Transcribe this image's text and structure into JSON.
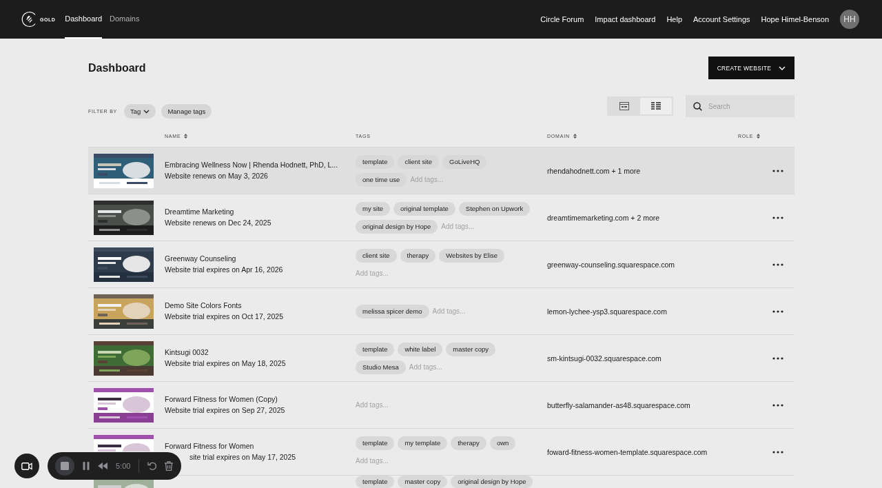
{
  "nav": {
    "logo_text": "GOLD",
    "tabs": [
      {
        "label": "Dashboard",
        "selected": true
      },
      {
        "label": "Domains",
        "selected": false
      }
    ],
    "links": [
      "Circle Forum",
      "Impact dashboard",
      "Help",
      "Account Settings"
    ],
    "user_name": "Hope Himel-Benson",
    "avatar_initials": "HH"
  },
  "page": {
    "title": "Dashboard",
    "create_button": "CREATE WEBSITE"
  },
  "filters": {
    "label": "FILTER BY",
    "tag_dropdown": "Tag",
    "manage_button": "Manage tags"
  },
  "view_toggle": [
    {
      "kind": "grid",
      "selected": false
    },
    {
      "kind": "list",
      "selected": true
    }
  ],
  "search": {
    "placeholder": "Search"
  },
  "table": {
    "columns": [
      {
        "label": "NAME",
        "sortable": true
      },
      {
        "label": "TAGS",
        "sortable": false
      },
      {
        "label": "DOMAIN",
        "sortable": true
      },
      {
        "label": "ROLE",
        "sortable": true
      }
    ],
    "rows": [
      {
        "name": "Embracing Wellness Now | Rhenda Hodnett, PhD, L...",
        "status": "Website renews on May 3, 2026",
        "tags": [
          "template",
          "client site",
          "GoLiveHQ",
          "one time use"
        ],
        "tag_placeholder": "Add tags...",
        "domain": "rhendahodnett.com + 1 more",
        "highlighted": true,
        "status_partly_hidden": false
      },
      {
        "name": "Dreamtime Marketing",
        "status": "Website renews on Dec 24, 2025",
        "tags": [
          "my site",
          "original template",
          "Stephen on Upwork",
          "original design by Hope"
        ],
        "tag_placeholder": "Add tags...",
        "domain": "dreamtimemarketing.com + 2 more",
        "highlighted": false,
        "status_partly_hidden": false
      },
      {
        "name": "Greenway Counseling",
        "status": "Website trial expires on Apr 16, 2026",
        "tags": [
          "client site",
          "therapy",
          "Websites by Elise"
        ],
        "tag_placeholder": "Add tags...",
        "domain": "greenway-counseling.squarespace.com",
        "highlighted": false,
        "status_partly_hidden": false
      },
      {
        "name": "Demo Site Colors Fonts",
        "status": "Website trial expires on Oct 17, 2025",
        "tags": [
          "melissa spicer demo"
        ],
        "tag_placeholder": "Add tags...",
        "domain": "lemon-lychee-ysp3.squarespace.com",
        "highlighted": false,
        "status_partly_hidden": false
      },
      {
        "name": "Kintsugi 0032",
        "status": "Website trial expires on May 18, 2025",
        "tags": [
          "template",
          "white label",
          "master copy",
          "Studio Mesa"
        ],
        "tag_placeholder": "Add tags...",
        "domain": "sm-kintsugi-0032.squarespace.com",
        "highlighted": false,
        "status_partly_hidden": false
      },
      {
        "name": "Forward Fitness for Women (Copy)",
        "status": "Website trial expires on Sep 27, 2025",
        "tags": [],
        "tag_placeholder": "Add tags...",
        "domain": "butterfly-salamander-as48.squarespace.com",
        "highlighted": false,
        "status_partly_hidden": false
      },
      {
        "name": "Forward Fitness for Women",
        "status": "site trial expires on May 17, 2025",
        "tags": [
          "template",
          "my template",
          "therapy",
          "own"
        ],
        "tag_placeholder": "Add tags...",
        "domain": "foward-fitness-women-template.squarespace.com",
        "highlighted": false,
        "status_partly_hidden": true
      },
      {
        "tags": [
          "template",
          "master copy",
          "original design by Hope"
        ],
        "highlighted": false
      }
    ]
  },
  "recorder": {
    "time": "5:00"
  }
}
